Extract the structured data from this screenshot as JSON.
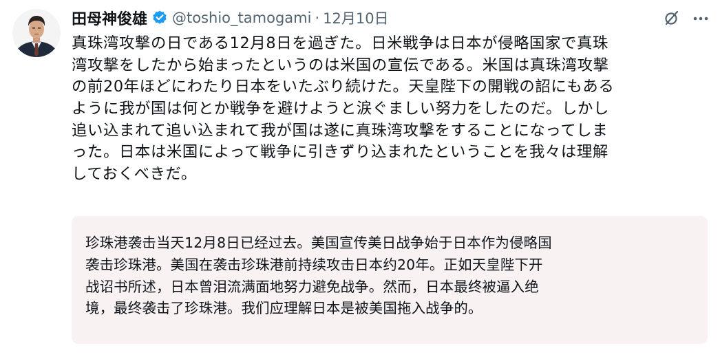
{
  "author": {
    "display_name": "田母神俊雄",
    "handle": "@toshio_tamogami",
    "separator": "·",
    "date": "12月10日",
    "verified": true
  },
  "icons": {
    "avatar": "avatar",
    "verified": "verified-badge-icon",
    "grok": "grok-icon",
    "more": "more-icon"
  },
  "colors": {
    "text_primary": "#0f1419",
    "text_secondary": "#536471",
    "verified_blue": "#1d9bf0",
    "translation_bg": "#f8f2f2"
  },
  "tweet": {
    "lines": [
      "真珠湾攻撃の日である12月8日を過ぎた。日米戦争は日本が侵略国家で真珠",
      "湾攻撃をしたから始まったというのは米国の宣伝である。米国は真珠湾攻撃",
      "の前20年ほどにわたり日本をいたぶり続けた。天皇陛下の開戦の詔にもある",
      "ように我が国は何とか戦争を避けようと涙ぐましい努力をしたのだ。しかし",
      "追い込まれて追い込まれて我が国は遂に真珠湾攻撃をすることになってしま",
      "った。日本は米国によって戦争に引きずり込まれたということを我々は理解",
      "しておくべきだ。"
    ]
  },
  "translation": {
    "lines": [
      "珍珠港袭击当天12月8日已经过去。美国宣传美日战争始于日本作为侵略国",
      "袭击珍珠港。美国在袭击珍珠港前持续攻击日本约20年。正如天皇陛下开",
      "战诏书所述，日本曾泪流满面地努力避免战争。然而，日本最终被逼入绝",
      "境，最终袭击了珍珠港。我们应理解日本是被美国拖入战争的。"
    ]
  }
}
